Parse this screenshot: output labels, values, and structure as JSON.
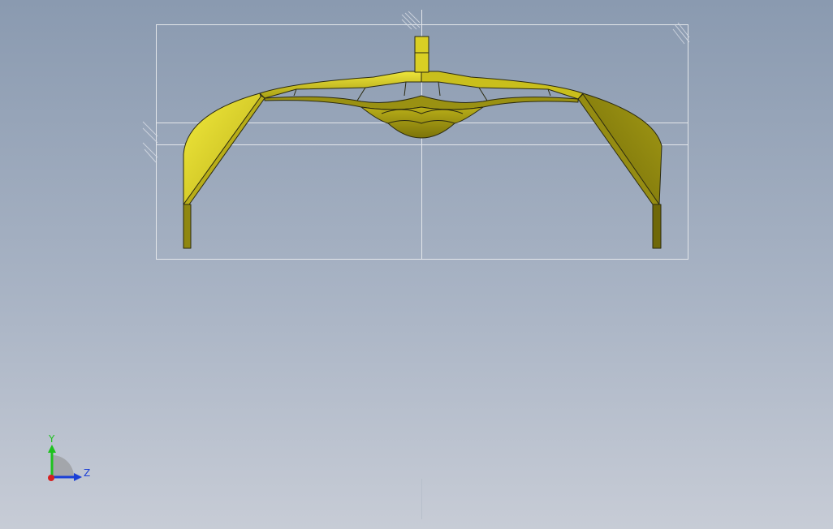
{
  "viewport": {
    "background_top": "#8a9ab0",
    "background_bottom": "#c7ccd6"
  },
  "model": {
    "name": "yellow-sheet-metal-part",
    "face_color": "#e6df2a",
    "shadow_color": "#8a8010",
    "edge_color": "#2b2a10"
  },
  "triad": {
    "y_label": "Y",
    "z_label": "Z",
    "y_color": "#1ec21e",
    "z_color": "#1b3fd6",
    "x_color": "#d62020"
  }
}
